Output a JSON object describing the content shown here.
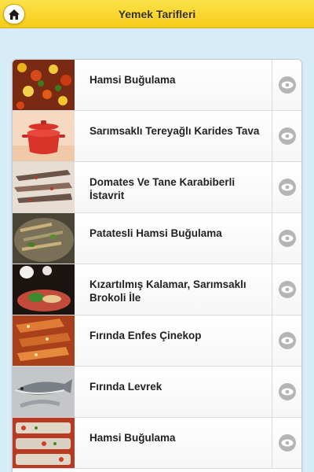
{
  "header": {
    "title": "Yemek Tarifleri",
    "home_icon": "home-icon",
    "color": "#f5cc18"
  },
  "recipes": [
    {
      "title": "Hamsi Buğulama"
    },
    {
      "title": "Sarımsaklı Tereyağlı Karides Tava"
    },
    {
      "title": "Domates Ve Tane Karabiberli İstavrit"
    },
    {
      "title": "Patatesli Hamsi Buğulama"
    },
    {
      "title": "Kızartılmış Kalamar, Sarımsaklı Brokoli İle"
    },
    {
      "title": "Fırında Enfes Çinekop"
    },
    {
      "title": "Fırında Levrek"
    },
    {
      "title": "Hamsi Buğulama"
    }
  ],
  "row_action_icon": "eye-icon"
}
